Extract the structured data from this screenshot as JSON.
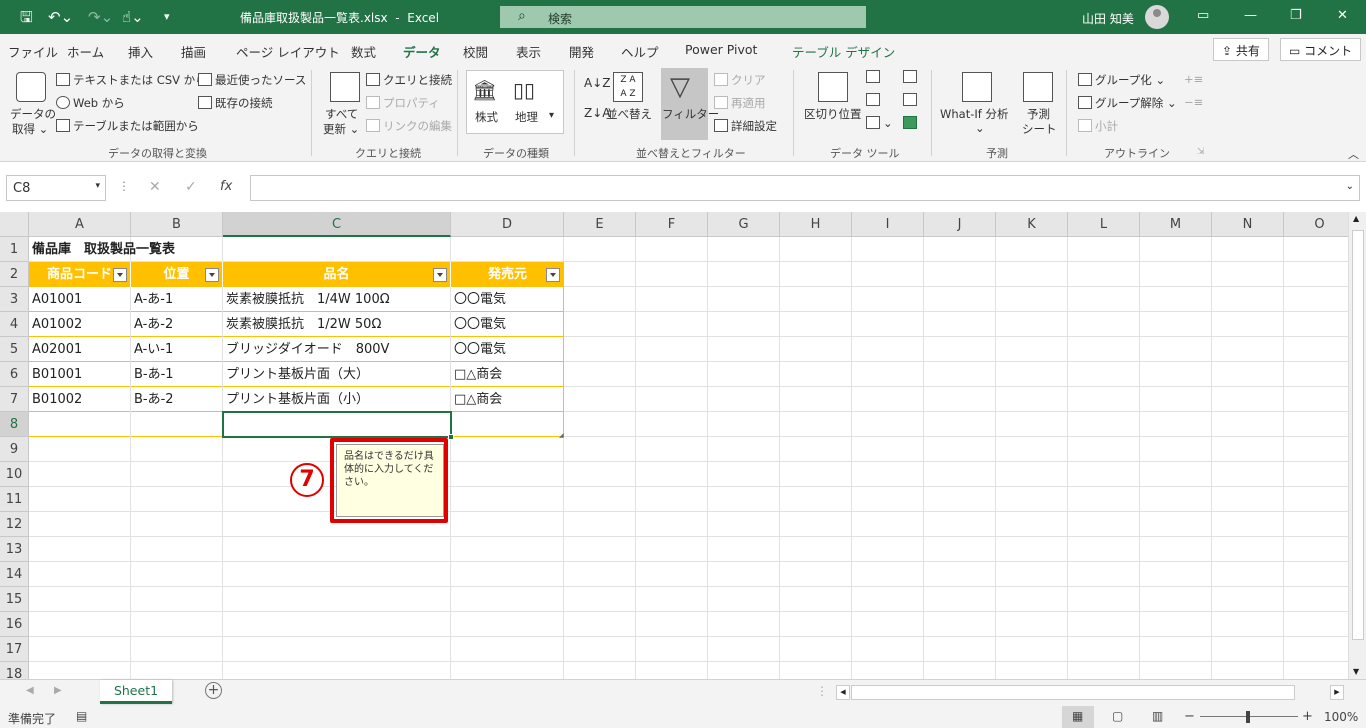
{
  "titlebar": {
    "filename": "備品庫取扱製品一覧表.xlsx",
    "separator": "-",
    "app": "Excel",
    "search_placeholder": "検索",
    "user_name": "山田 知美"
  },
  "tabs": [
    "ファイル",
    "ホーム",
    "挿入",
    "描画",
    "ページ レイアウト",
    "数式",
    "データ",
    "校閲",
    "表示",
    "開発",
    "ヘルプ",
    "Power Pivot",
    "テーブル デザイン"
  ],
  "active_tab": "データ",
  "share_label": "共有",
  "comment_label": "コメント",
  "ribbon": {
    "get_data": {
      "label1": "データの",
      "label2": "取得 ⌄",
      "text_csv": "テキストまたは CSV から",
      "web": "Web から",
      "table_range": "テーブルまたは範囲から",
      "recent": "最近使ったソース",
      "existing": "既存の接続",
      "group": "データの取得と変換"
    },
    "queries": {
      "refresh1": "すべて",
      "refresh2": "更新 ⌄",
      "queries_conn": "クエリと接続",
      "properties": "プロパティ",
      "edit_links": "リンクの編集",
      "group": "クエリと接続"
    },
    "types": {
      "stocks": "株式",
      "geo": "地理",
      "group": "データの種類"
    },
    "sort": {
      "sort": "並べ替え",
      "filter": "フィルター",
      "clear": "クリア",
      "reapply": "再適用",
      "advanced": "詳細設定",
      "group": "並べ替えとフィルター"
    },
    "tools": {
      "text_to_col": "区切り位置",
      "group": "データ ツール"
    },
    "forecast": {
      "whatif": "What-If 分析",
      "sheet1": "予測",
      "sheet2": "シート",
      "group": "予測"
    },
    "outline": {
      "group_btn": "グループ化",
      "ungroup": "グループ解除",
      "subtotal": "小計",
      "group": "アウトライン"
    }
  },
  "formula_bar": {
    "name_box": "C8",
    "fx": "fx",
    "value": ""
  },
  "columns": [
    "A",
    "B",
    "C",
    "D",
    "E",
    "F",
    "G",
    "H",
    "I",
    "J",
    "K",
    "L",
    "M",
    "N",
    "O"
  ],
  "rows": [
    "1",
    "2",
    "3",
    "4",
    "5",
    "6",
    "7",
    "8",
    "9",
    "10",
    "11",
    "12",
    "13",
    "14",
    "15",
    "16",
    "17",
    "18"
  ],
  "sheet": {
    "title": "備品庫　取扱製品一覧表",
    "headers": [
      "商品コード",
      "位置",
      "品名",
      "発売元"
    ],
    "data": [
      [
        "A01001",
        "A-あ-1",
        "炭素被膜抵抗　1/4W 100Ω",
        "〇〇電気"
      ],
      [
        "A01002",
        "A-あ-2",
        "炭素被膜抵抗　1/2W 50Ω",
        "〇〇電気"
      ],
      [
        "A02001",
        "A-い-1",
        "ブリッジダイオード　800V",
        "〇〇電気"
      ],
      [
        "B01001",
        "B-あ-1",
        "プリント基板片面（大）",
        "□△商会"
      ],
      [
        "B01002",
        "B-あ-2",
        "プリント基板片面（小）",
        "□△商会"
      ]
    ]
  },
  "input_tip": "品名はできるだけ具体的に入力してください。",
  "callout_number": "7",
  "sheet_tab": "Sheet1",
  "status": {
    "ready": "準備完了",
    "zoom": "100%"
  },
  "colors": {
    "excel_green": "#217346",
    "table_header": "#ffc000",
    "callout": "#e00000"
  }
}
